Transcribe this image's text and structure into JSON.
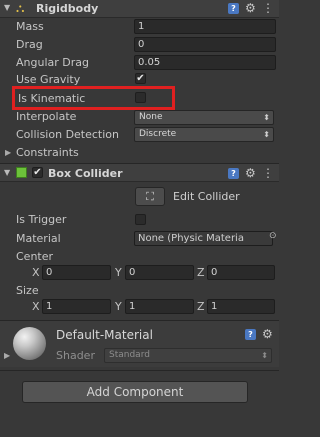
{
  "rigidbody": {
    "title": "Rigidbody",
    "mass_label": "Mass",
    "mass_value": "1",
    "drag_label": "Drag",
    "drag_value": "0",
    "angular_drag_label": "Angular Drag",
    "angular_drag_value": "0.05",
    "use_gravity_label": "Use Gravity",
    "use_gravity_checked": true,
    "is_kinematic_label": "Is Kinematic",
    "is_kinematic_checked": false,
    "interpolate_label": "Interpolate",
    "interpolate_value": "None",
    "collision_label": "Collision Detection",
    "collision_value": "Discrete",
    "constraints_label": "Constraints"
  },
  "box_collider": {
    "title": "Box Collider",
    "edit_collider_label": "Edit Collider",
    "is_trigger_label": "Is Trigger",
    "material_label": "Material",
    "material_value": "None (Physic Materia",
    "center_label": "Center",
    "center": {
      "x": "0",
      "y": "0",
      "z": "0"
    },
    "size_label": "Size",
    "size": {
      "x": "1",
      "y": "1",
      "z": "1"
    }
  },
  "axis_labels": {
    "x": "X",
    "y": "Y",
    "z": "Z"
  },
  "material": {
    "name": "Default-Material",
    "shader_label": "Shader",
    "shader_value": "Standard"
  },
  "add_component_label": "Add Component",
  "highlight_color": "#e02020"
}
